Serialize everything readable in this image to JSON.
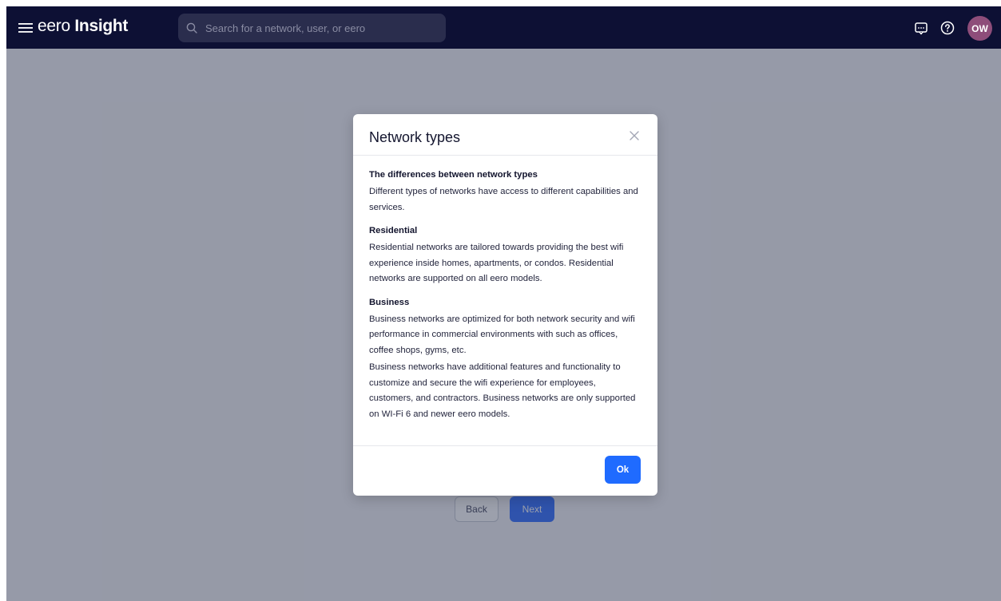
{
  "header": {
    "brand_light": "eero",
    "brand_bold": "Insight",
    "search_placeholder": "Search for a network, user, or eero",
    "avatar_initials": "OW"
  },
  "page": {
    "back_label": "Back",
    "next_label": "Next"
  },
  "modal": {
    "title": "Network types",
    "sections": [
      {
        "heading": "The differences between network types",
        "paragraphs": [
          "Different types of networks have access to different capabilities and services."
        ]
      },
      {
        "heading": "Residential",
        "paragraphs": [
          "Residential networks are tailored towards providing the best wifi experience inside homes, apartments, or condos. Residential networks are supported on all eero models."
        ]
      },
      {
        "heading": "Business",
        "paragraphs": [
          "Business networks are optimized for both network security and wifi performance in commercial environments with such as offices, coffee shops, gyms, etc.",
          "Business networks have additional features and functionality to customize and secure the wifi experience for employees, customers, and contractors. Business networks are only supported on WI-Fi 6 and newer eero models."
        ]
      }
    ],
    "ok_label": "Ok"
  },
  "colors": {
    "topbar": "#0d1034",
    "accent": "#1f6bff",
    "avatar": "#8e4d7a"
  },
  "icons": [
    "menu-icon",
    "search-icon",
    "chat-icon",
    "help-icon",
    "close-icon"
  ]
}
